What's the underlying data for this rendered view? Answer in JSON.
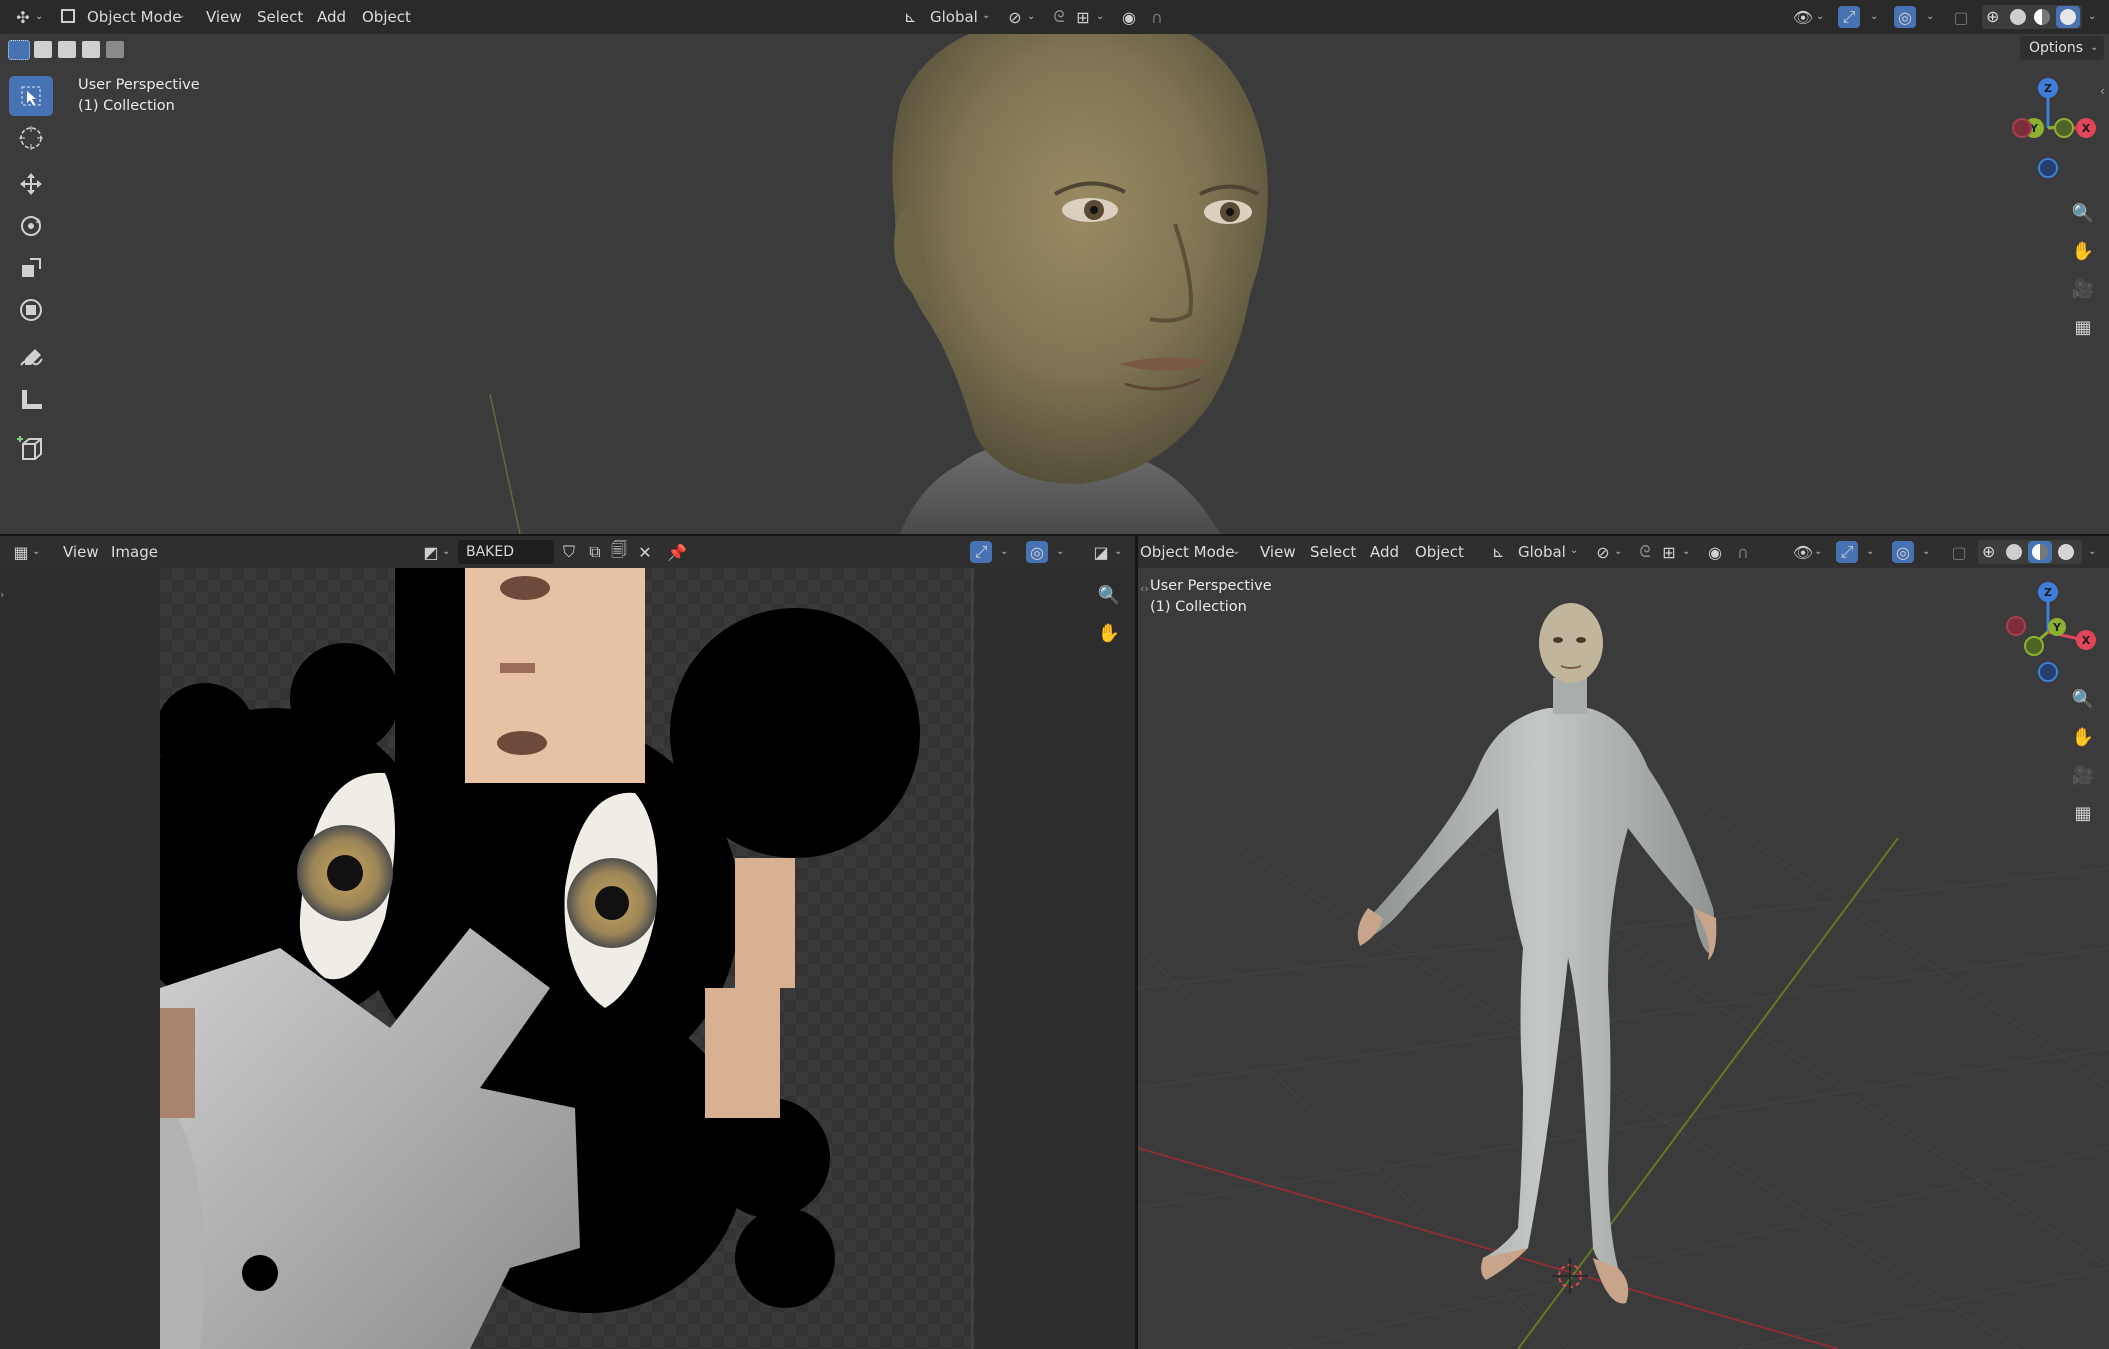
{
  "top_viewport": {
    "header": {
      "mode": "Object Mode",
      "menus": [
        "View",
        "Select",
        "Add",
        "Object"
      ],
      "transform_orientation": "Global",
      "options": "Options"
    },
    "overlay": {
      "line1": "User Perspective",
      "line2": "(1) Collection"
    }
  },
  "image_editor": {
    "header": {
      "menus": [
        "View",
        "Image"
      ],
      "image_name": "BAKED"
    }
  },
  "bottom_viewport": {
    "header": {
      "mode": "Object Mode",
      "menus": [
        "View",
        "Select",
        "Add",
        "Object"
      ],
      "transform_orientation": "Global"
    },
    "overlay": {
      "line1": "User Perspective",
      "line2": "(1) Collection"
    }
  },
  "gizmo": {
    "x": "X",
    "y": "Y",
    "z": "Z"
  },
  "colors": {
    "x_axis": "#e0455a",
    "y_axis": "#8bb12f",
    "z_axis": "#3d7ddc",
    "accent": "#4772b3"
  }
}
